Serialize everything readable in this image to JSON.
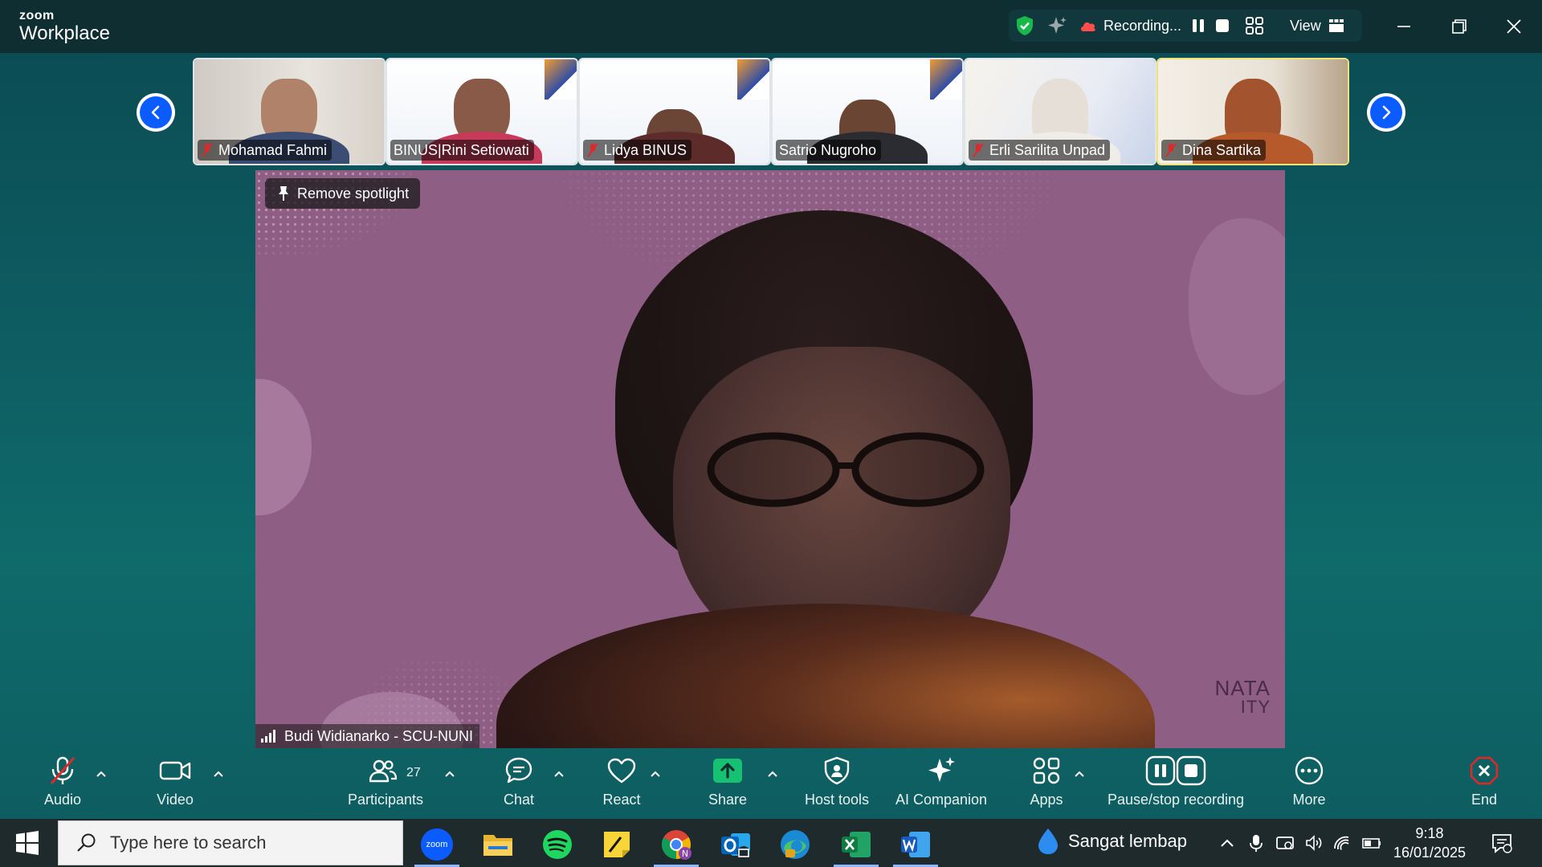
{
  "app": {
    "brand_small": "zoom",
    "brand_big": "Workplace"
  },
  "topbar": {
    "recording_label": "Recording...",
    "view_label": "View"
  },
  "thumbnails": [
    {
      "name": "Mohamad Fahmi",
      "muted": true
    },
    {
      "name": "BINUS|Rini Setiowati",
      "muted": false
    },
    {
      "name": "Lidya BINUS",
      "muted": true
    },
    {
      "name": "Satrio Nugroho",
      "muted": false
    },
    {
      "name": "Erli Sarilita Unpad",
      "muted": true
    },
    {
      "name": "Dina Sartika",
      "muted": true
    }
  ],
  "main_video": {
    "spotlight_button": "Remove spotlight",
    "speaker_name": "Budi Widianarko - SCU-NUNI",
    "watermark_line1": "NATA",
    "watermark_line2": "ITY"
  },
  "toolbar": {
    "audio": "Audio",
    "video": "Video",
    "participants": "Participants",
    "participants_count": "27",
    "chat": "Chat",
    "react": "React",
    "share": "Share",
    "host_tools": "Host tools",
    "ai_companion": "AI Companion",
    "apps": "Apps",
    "pause_stop_recording": "Pause/stop recording",
    "more": "More",
    "end": "End"
  },
  "taskbar": {
    "search_placeholder": "Type here to search",
    "weather": "Sangat lembap",
    "time": "9:18",
    "date": "16/01/2025"
  },
  "colors": {
    "accent_blue": "#0b5cff",
    "share_green": "#16c172",
    "end_red": "#e02828",
    "mute_red": "#e02828",
    "shield_green": "#19b84a"
  }
}
